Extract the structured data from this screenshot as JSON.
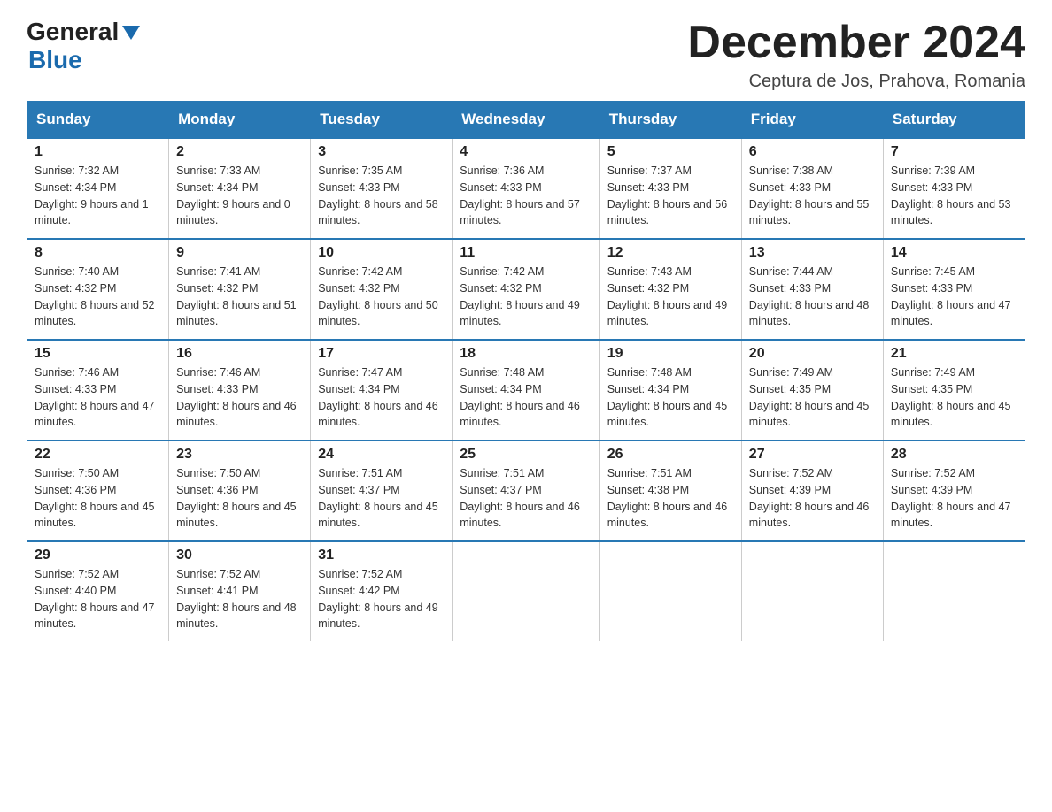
{
  "logo": {
    "text_general": "General",
    "text_blue": "Blue"
  },
  "title": "December 2024",
  "subtitle": "Ceptura de Jos, Prahova, Romania",
  "days_of_week": [
    "Sunday",
    "Monday",
    "Tuesday",
    "Wednesday",
    "Thursday",
    "Friday",
    "Saturday"
  ],
  "weeks": [
    [
      {
        "day": "1",
        "sunrise": "7:32 AM",
        "sunset": "4:34 PM",
        "daylight": "9 hours and 1 minute."
      },
      {
        "day": "2",
        "sunrise": "7:33 AM",
        "sunset": "4:34 PM",
        "daylight": "9 hours and 0 minutes."
      },
      {
        "day": "3",
        "sunrise": "7:35 AM",
        "sunset": "4:33 PM",
        "daylight": "8 hours and 58 minutes."
      },
      {
        "day": "4",
        "sunrise": "7:36 AM",
        "sunset": "4:33 PM",
        "daylight": "8 hours and 57 minutes."
      },
      {
        "day": "5",
        "sunrise": "7:37 AM",
        "sunset": "4:33 PM",
        "daylight": "8 hours and 56 minutes."
      },
      {
        "day": "6",
        "sunrise": "7:38 AM",
        "sunset": "4:33 PM",
        "daylight": "8 hours and 55 minutes."
      },
      {
        "day": "7",
        "sunrise": "7:39 AM",
        "sunset": "4:33 PM",
        "daylight": "8 hours and 53 minutes."
      }
    ],
    [
      {
        "day": "8",
        "sunrise": "7:40 AM",
        "sunset": "4:32 PM",
        "daylight": "8 hours and 52 minutes."
      },
      {
        "day": "9",
        "sunrise": "7:41 AM",
        "sunset": "4:32 PM",
        "daylight": "8 hours and 51 minutes."
      },
      {
        "day": "10",
        "sunrise": "7:42 AM",
        "sunset": "4:32 PM",
        "daylight": "8 hours and 50 minutes."
      },
      {
        "day": "11",
        "sunrise": "7:42 AM",
        "sunset": "4:32 PM",
        "daylight": "8 hours and 49 minutes."
      },
      {
        "day": "12",
        "sunrise": "7:43 AM",
        "sunset": "4:32 PM",
        "daylight": "8 hours and 49 minutes."
      },
      {
        "day": "13",
        "sunrise": "7:44 AM",
        "sunset": "4:33 PM",
        "daylight": "8 hours and 48 minutes."
      },
      {
        "day": "14",
        "sunrise": "7:45 AM",
        "sunset": "4:33 PM",
        "daylight": "8 hours and 47 minutes."
      }
    ],
    [
      {
        "day": "15",
        "sunrise": "7:46 AM",
        "sunset": "4:33 PM",
        "daylight": "8 hours and 47 minutes."
      },
      {
        "day": "16",
        "sunrise": "7:46 AM",
        "sunset": "4:33 PM",
        "daylight": "8 hours and 46 minutes."
      },
      {
        "day": "17",
        "sunrise": "7:47 AM",
        "sunset": "4:34 PM",
        "daylight": "8 hours and 46 minutes."
      },
      {
        "day": "18",
        "sunrise": "7:48 AM",
        "sunset": "4:34 PM",
        "daylight": "8 hours and 46 minutes."
      },
      {
        "day": "19",
        "sunrise": "7:48 AM",
        "sunset": "4:34 PM",
        "daylight": "8 hours and 45 minutes."
      },
      {
        "day": "20",
        "sunrise": "7:49 AM",
        "sunset": "4:35 PM",
        "daylight": "8 hours and 45 minutes."
      },
      {
        "day": "21",
        "sunrise": "7:49 AM",
        "sunset": "4:35 PM",
        "daylight": "8 hours and 45 minutes."
      }
    ],
    [
      {
        "day": "22",
        "sunrise": "7:50 AM",
        "sunset": "4:36 PM",
        "daylight": "8 hours and 45 minutes."
      },
      {
        "day": "23",
        "sunrise": "7:50 AM",
        "sunset": "4:36 PM",
        "daylight": "8 hours and 45 minutes."
      },
      {
        "day": "24",
        "sunrise": "7:51 AM",
        "sunset": "4:37 PM",
        "daylight": "8 hours and 45 minutes."
      },
      {
        "day": "25",
        "sunrise": "7:51 AM",
        "sunset": "4:37 PM",
        "daylight": "8 hours and 46 minutes."
      },
      {
        "day": "26",
        "sunrise": "7:51 AM",
        "sunset": "4:38 PM",
        "daylight": "8 hours and 46 minutes."
      },
      {
        "day": "27",
        "sunrise": "7:52 AM",
        "sunset": "4:39 PM",
        "daylight": "8 hours and 46 minutes."
      },
      {
        "day": "28",
        "sunrise": "7:52 AM",
        "sunset": "4:39 PM",
        "daylight": "8 hours and 47 minutes."
      }
    ],
    [
      {
        "day": "29",
        "sunrise": "7:52 AM",
        "sunset": "4:40 PM",
        "daylight": "8 hours and 47 minutes."
      },
      {
        "day": "30",
        "sunrise": "7:52 AM",
        "sunset": "4:41 PM",
        "daylight": "8 hours and 48 minutes."
      },
      {
        "day": "31",
        "sunrise": "7:52 AM",
        "sunset": "4:42 PM",
        "daylight": "8 hours and 49 minutes."
      },
      null,
      null,
      null,
      null
    ]
  ]
}
